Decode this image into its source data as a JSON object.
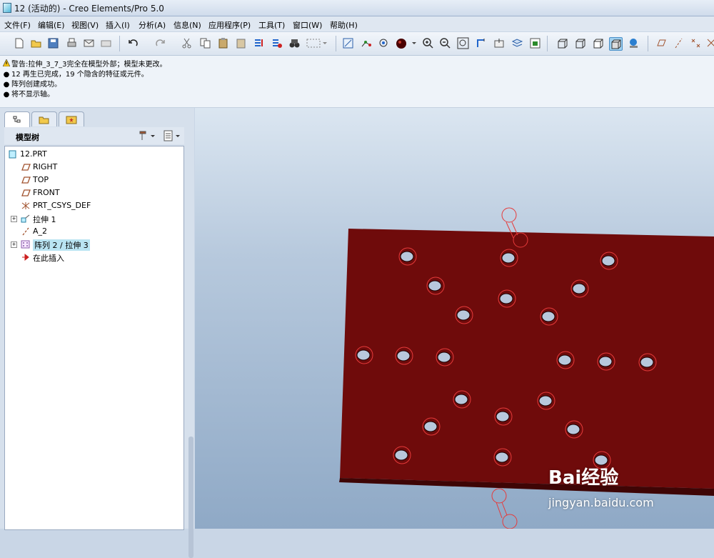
{
  "window": {
    "title": "12 (活动的) - Creo Elements/Pro 5.0"
  },
  "menu": [
    {
      "label": "文件(F)"
    },
    {
      "label": "编辑(E)"
    },
    {
      "label": "视图(V)"
    },
    {
      "label": "插入(I)"
    },
    {
      "label": "分析(A)"
    },
    {
      "label": "信息(N)"
    },
    {
      "label": "应用程序(P)"
    },
    {
      "label": "工具(T)"
    },
    {
      "label": "窗口(W)"
    },
    {
      "label": "帮助(H)"
    }
  ],
  "messages": [
    {
      "icon": "warning-icon",
      "text": "警告:拉伸_3_7_3完全在模型外部；模型未更改。"
    },
    {
      "icon": "info-bullet-icon",
      "text": "12 再生已完成，19 个隐含的特征或元件。"
    },
    {
      "icon": "info-bullet-icon",
      "text": "阵列创建成功。"
    },
    {
      "icon": "info-bullet-icon",
      "text": "将不显示轴。"
    }
  ],
  "panel": {
    "tabs": [
      {
        "icon": "model-tree-icon"
      },
      {
        "icon": "folder-browser-icon"
      },
      {
        "icon": "favorites-icon"
      }
    ],
    "header": "模型树"
  },
  "tree": [
    {
      "label": "12.PRT",
      "icon": "part-icon"
    },
    {
      "label": "RIGHT",
      "icon": "datum-plane-icon"
    },
    {
      "label": "TOP",
      "icon": "datum-plane-icon"
    },
    {
      "label": "FRONT",
      "icon": "datum-plane-icon"
    },
    {
      "label": "PRT_CSYS_DEF",
      "icon": "csys-icon"
    },
    {
      "label": "拉伸 1",
      "icon": "extrude-icon"
    },
    {
      "label": "A_2",
      "icon": "datum-axis-icon"
    },
    {
      "label": "阵列 2 / 拉伸 3",
      "icon": "pattern-icon"
    },
    {
      "label": "在此插入",
      "icon": "insert-arrow-icon"
    }
  ],
  "colors": {
    "plate": "#6f0b0b",
    "plate_edge": "#4a0606",
    "hole_fill": "#b8c8dc",
    "hole_outline": "#e63a3a"
  },
  "watermark": {
    "brand": "Bai经验",
    "url": "jingyan.baidu.com"
  }
}
